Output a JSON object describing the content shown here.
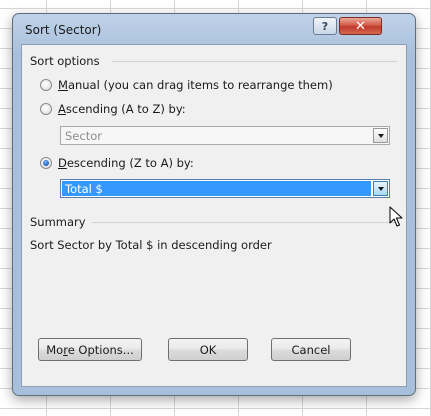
{
  "dialog": {
    "title": "Sort (Sector)",
    "help_icon": "question-mark-icon",
    "help_glyph": "?",
    "close_icon": "close-icon",
    "close_glyph": "✕"
  },
  "sort_options": {
    "heading": "Sort options",
    "manual": {
      "accel": "M",
      "rest": "anual (you can drag items to rearrange them)",
      "checked": false
    },
    "ascending": {
      "accel": "A",
      "rest": "scending (A to Z) by:",
      "checked": false,
      "combo_value": "Sector",
      "enabled": false
    },
    "descending": {
      "accel": "D",
      "rest": "escending (Z to A) by:",
      "checked": true,
      "combo_value": "Total $",
      "enabled": true
    }
  },
  "summary": {
    "heading": "Summary",
    "text": "Sort Sector by Total $ in descending order"
  },
  "buttons": {
    "more_options_pre": "Mo",
    "more_options_accel": "r",
    "more_options_post": "e Options...",
    "ok": "OK",
    "cancel": "Cancel"
  },
  "colors": {
    "selection": "#3399ff",
    "close_button": "#c0392b",
    "dialog_frame": "#a9c0dc"
  }
}
